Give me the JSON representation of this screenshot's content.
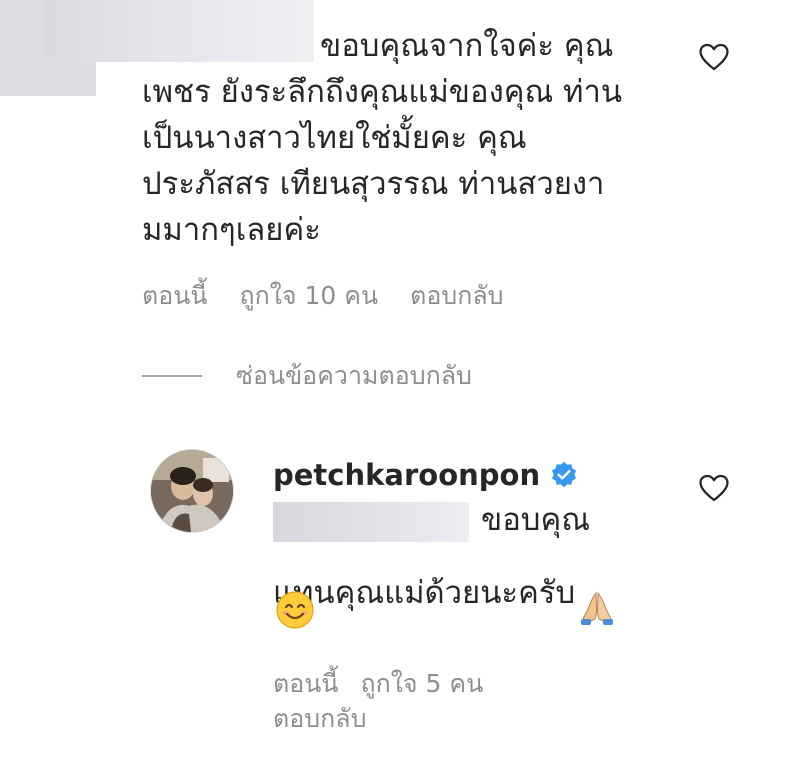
{
  "comment1": {
    "text": "ขอบคุณจากใจค่ะ คุณ\nเพชร ยังระลึกถึงคุณแม่ของคุณ ท่าน\nเป็นนางสาวไทยใช่มั้ยคะ คุณ\nประภัสสร เทียนสุวรรณ ท่านสวยงา\nมมากๆเลยค่ะ",
    "time": "ตอนนี้",
    "likes": "ถูกใจ 10 คน",
    "reply_label": "ตอบกลับ",
    "like_icon": "heart-outline"
  },
  "replies_toggle": {
    "label": "ซ่อนข้อความตอบกลับ"
  },
  "reply1": {
    "username": "petchkaroonpon",
    "verified": true,
    "text_line1": "ขอบคุณ",
    "text_line2": "แทนคุณแม่ด้วยนะครับ",
    "emoji_pray": "🙏",
    "emoji_smile": "😊",
    "time": "ตอนนี้",
    "likes": "ถูกใจ 5 คน",
    "reply_label": "ตอบกลับ",
    "like_icon": "heart-outline"
  },
  "colors": {
    "text": "#262626",
    "meta": "#8e8e8e",
    "verified_blue": "#3897f0"
  }
}
